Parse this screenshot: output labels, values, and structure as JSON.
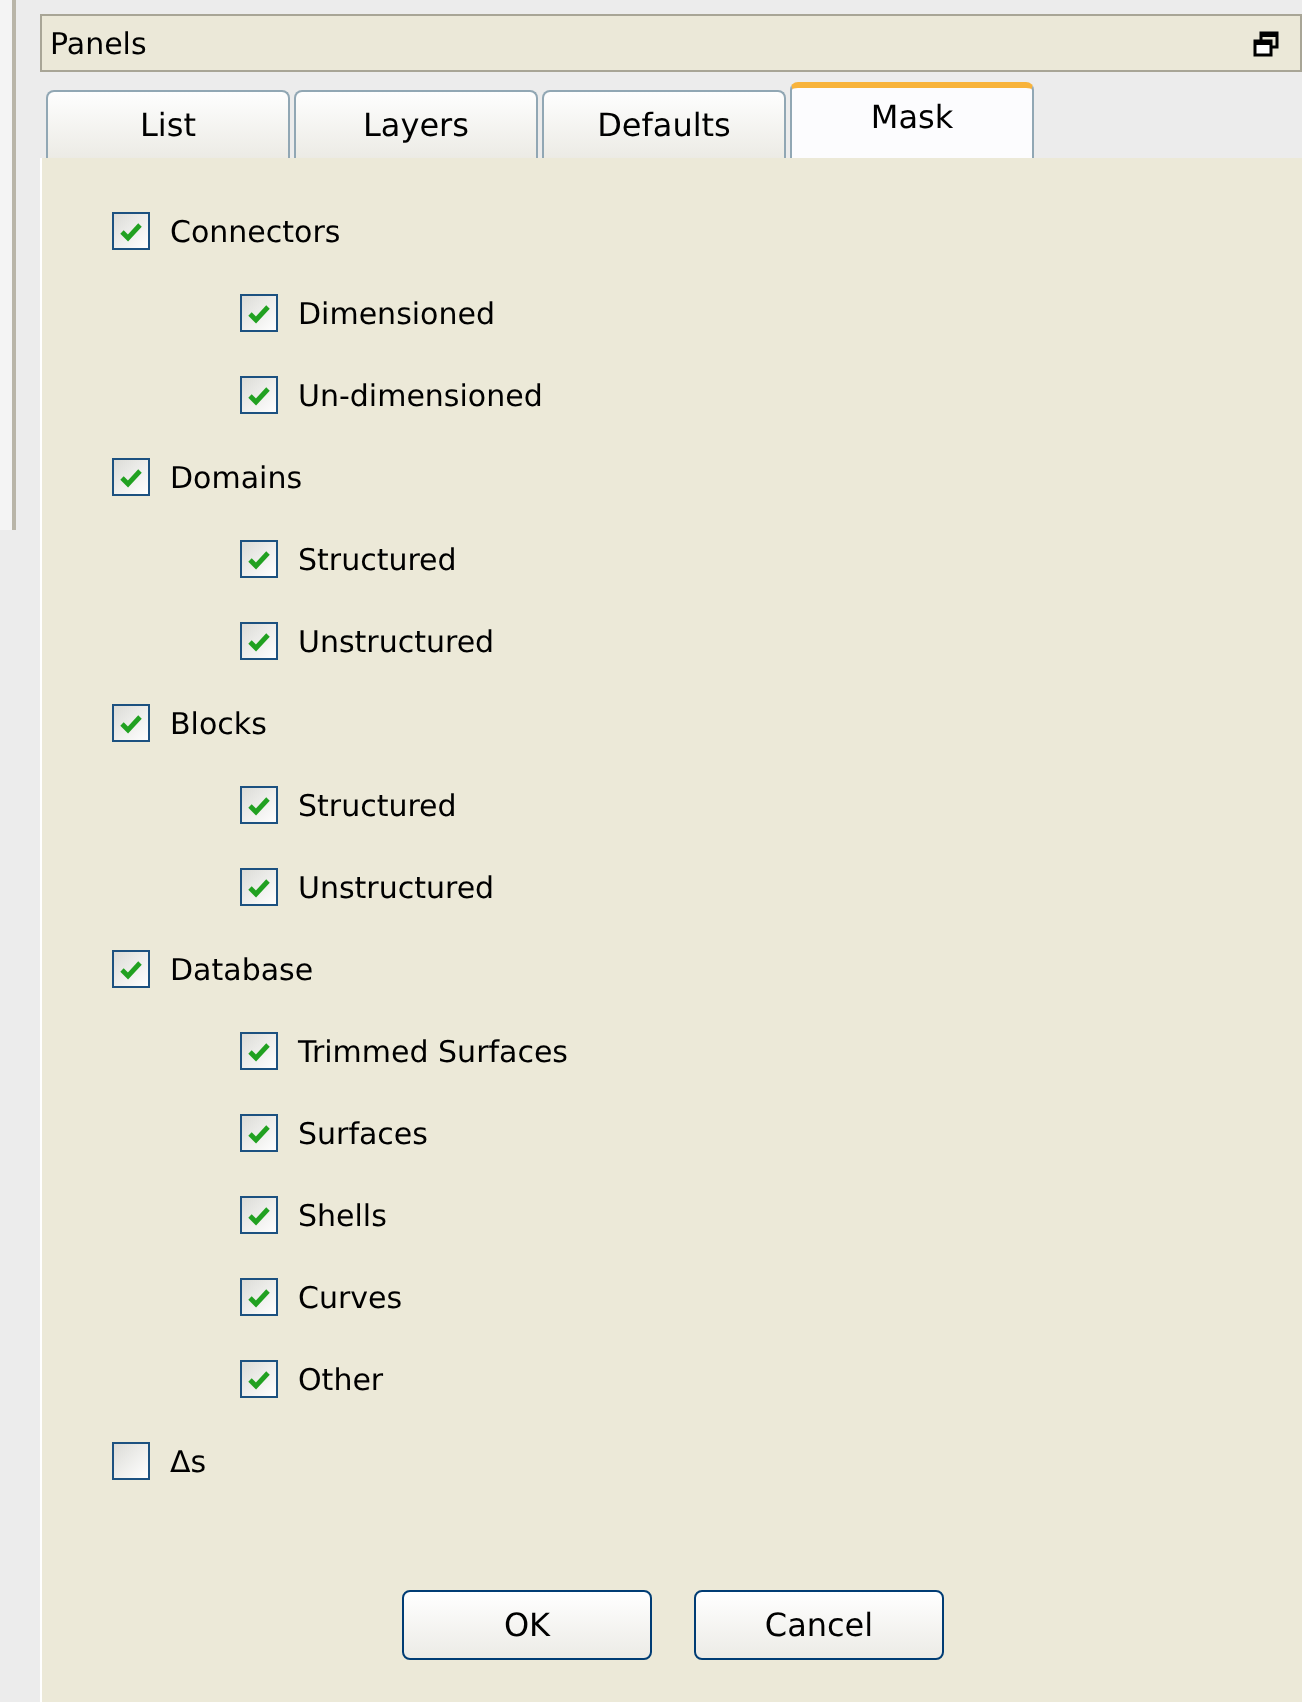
{
  "panel": {
    "title": "Panels"
  },
  "tabs": [
    {
      "label": "List",
      "selected": false
    },
    {
      "label": "Layers",
      "selected": false
    },
    {
      "label": "Defaults",
      "selected": false
    },
    {
      "label": "Mask",
      "selected": true
    }
  ],
  "mask": [
    {
      "label": "Connectors",
      "checked": true,
      "children": [
        {
          "label": "Dimensioned",
          "checked": true
        },
        {
          "label": "Un-dimensioned",
          "checked": true
        }
      ]
    },
    {
      "label": "Domains",
      "checked": true,
      "children": [
        {
          "label": "Structured",
          "checked": true
        },
        {
          "label": "Unstructured",
          "checked": true
        }
      ]
    },
    {
      "label": "Blocks",
      "checked": true,
      "children": [
        {
          "label": "Structured",
          "checked": true
        },
        {
          "label": "Unstructured",
          "checked": true
        }
      ]
    },
    {
      "label": "Database",
      "checked": true,
      "children": [
        {
          "label": "Trimmed Surfaces",
          "checked": true
        },
        {
          "label": "Surfaces",
          "checked": true
        },
        {
          "label": "Shells",
          "checked": true
        },
        {
          "label": "Curves",
          "checked": true
        },
        {
          "label": "Other",
          "checked": true
        }
      ]
    },
    {
      "label": "Δs",
      "checked": false
    }
  ],
  "buttons": [
    "OK",
    "Cancel"
  ]
}
